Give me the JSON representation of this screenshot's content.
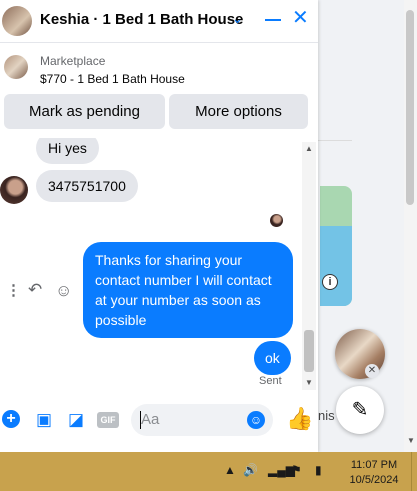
{
  "chat": {
    "title": "Keshia · 1 Bed 1 Bath House",
    "listing": {
      "source": "Marketplace",
      "item": "$770 - 1 Bed 1 Bath House"
    },
    "buttons": {
      "pending": "Mark as pending",
      "more": "More options"
    },
    "messages": [
      {
        "from": "them",
        "text": "Hi yes"
      },
      {
        "from": "them",
        "text": "3475751700"
      },
      {
        "from": "me",
        "text": "Thanks for sharing your contact number I will contact at your number as soon as possible"
      },
      {
        "from": "me",
        "text": "ok"
      }
    ],
    "status": "Sent",
    "composer": {
      "placeholder": "Aa",
      "gif_label": "GIF"
    }
  },
  "background": {
    "partial_text": "nis"
  },
  "taskbar": {
    "time": "11:07 PM",
    "date": "10/5/2024"
  },
  "colors": {
    "accent": "#0a7cff",
    "bubble_in": "#e4e6eb",
    "taskbar": "#c8a24d"
  }
}
